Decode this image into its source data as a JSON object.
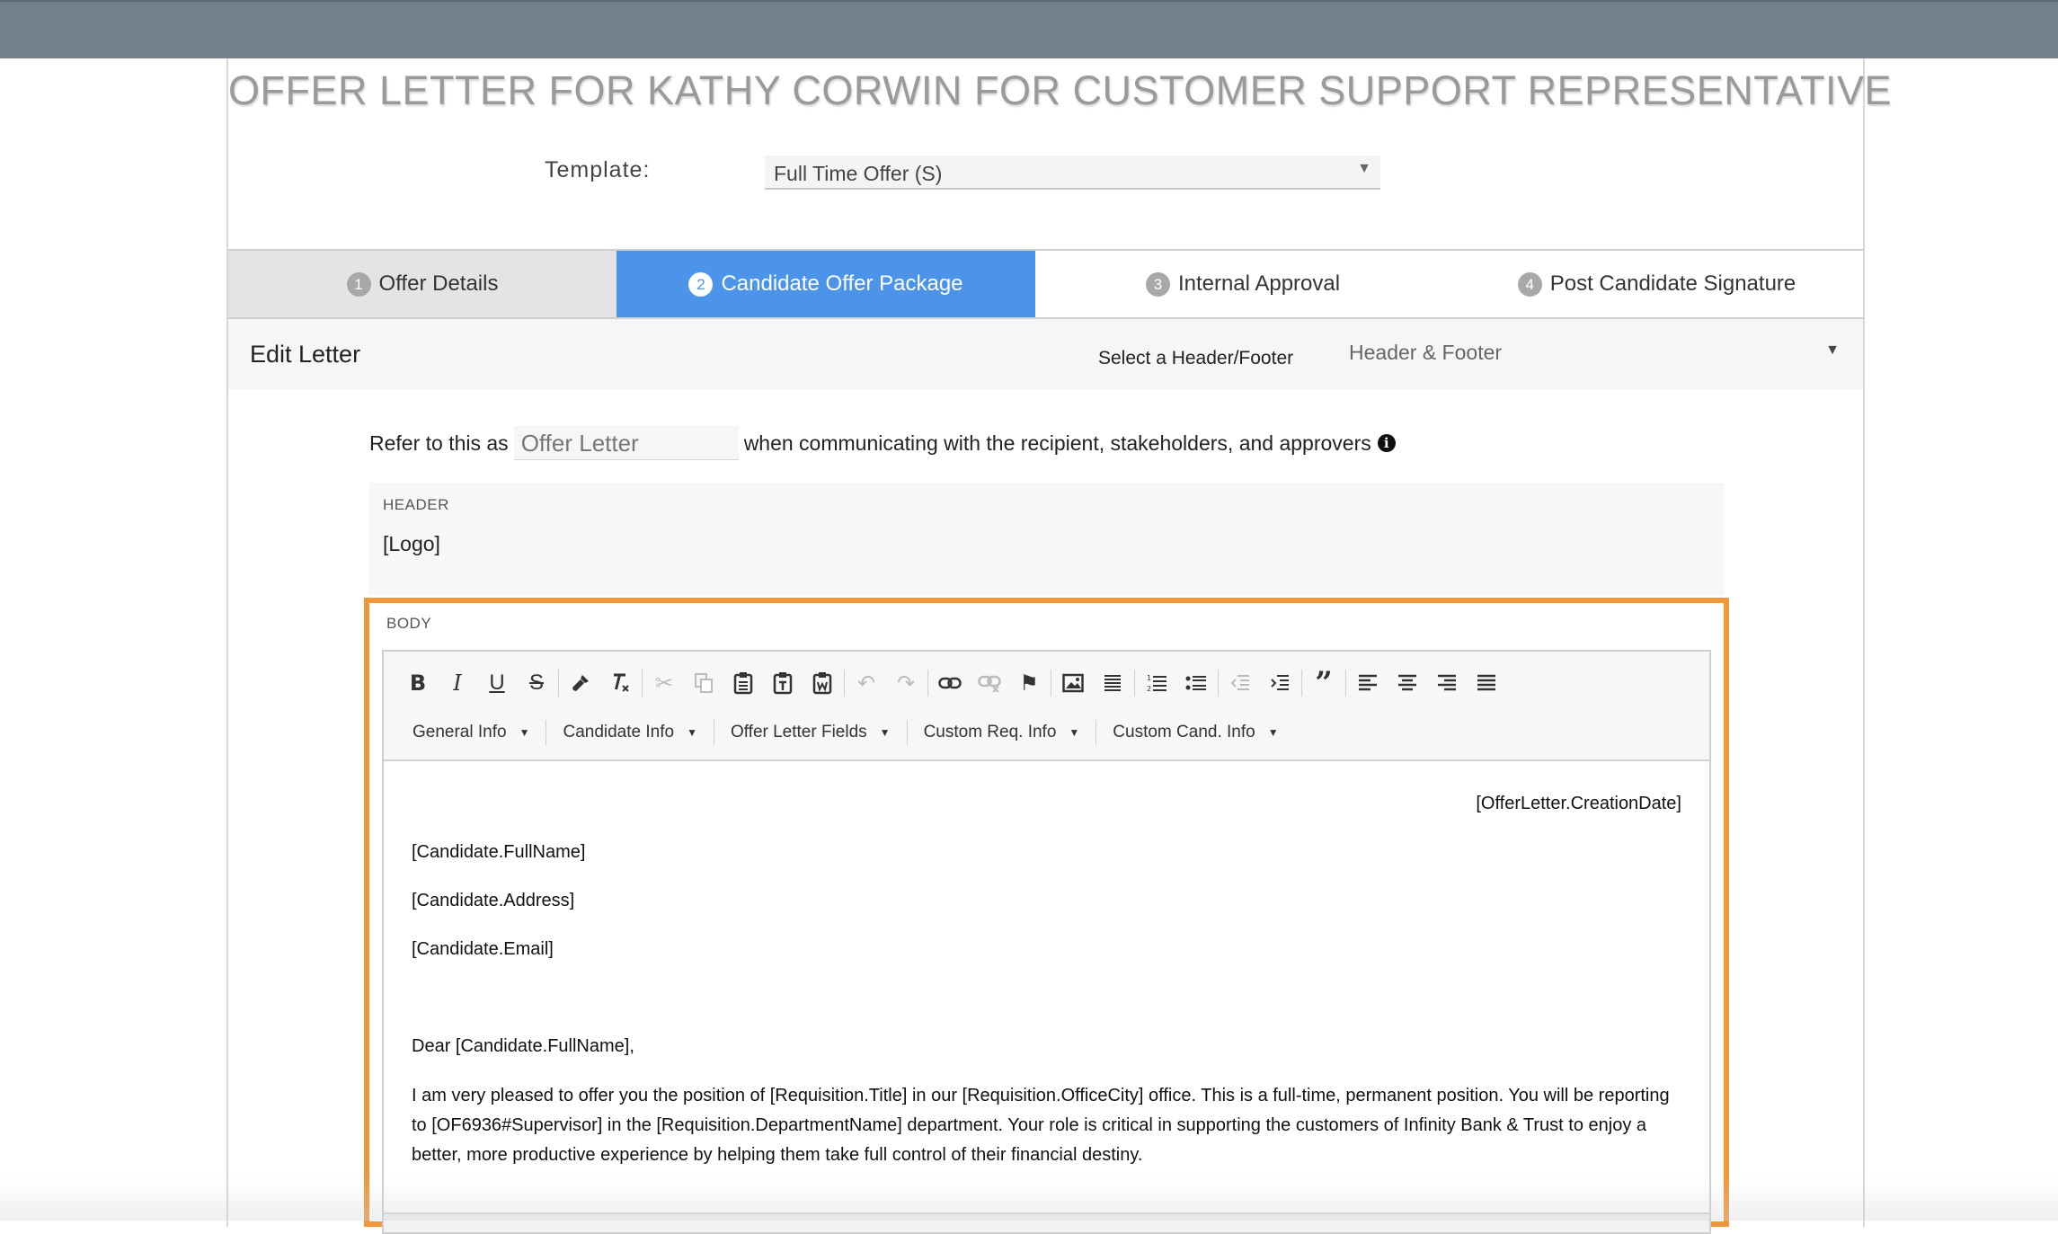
{
  "page": {
    "title": "OFFER LETTER FOR KATHY CORWIN FOR CUSTOMER SUPPORT REPRESENTATIVE"
  },
  "template": {
    "label": "Template:",
    "value": "Full Time Offer (S)"
  },
  "tabs": [
    {
      "num": "1",
      "label": "Offer Details",
      "state": "done"
    },
    {
      "num": "2",
      "label": "Candidate Offer Package",
      "state": "active"
    },
    {
      "num": "3",
      "label": "Internal Approval",
      "state": "pending"
    },
    {
      "num": "4",
      "label": "Post Candidate Signature",
      "state": "pending"
    }
  ],
  "edit": {
    "title": "Edit Letter",
    "header_footer_label": "Select a Header/Footer",
    "header_footer_value": "Header & Footer"
  },
  "refer": {
    "before": "Refer to this as",
    "value": "Offer Letter",
    "after": "when communicating with the recipient, stakeholders, and approvers",
    "info_icon": "i"
  },
  "header_section": {
    "label": "HEADER",
    "content": "[Logo]"
  },
  "body_section": {
    "label": "BODY",
    "dropdowns": [
      "General Info",
      "Candidate Info",
      "Offer Letter Fields",
      "Custom Req. Info",
      "Custom Cand. Info"
    ],
    "content": {
      "date": "[OfferLetter.CreationDate]",
      "name": "[Candidate.FullName]",
      "address": "[Candidate.Address]",
      "email": "[Candidate.Email]",
      "salutation": "Dear [Candidate.FullName],",
      "paragraph": "I am very pleased to offer you the position of [Requisition.Title] in our [Requisition.OfficeCity] office. This is a full-time, permanent position. You will be reporting to [OF6936#Supervisor] in the [Requisition.DepartmentName] department. Your role is critical in supporting the customers of Infinity Bank & Trust to enjoy a better, more productive experience by helping them take full control of their financial destiny."
    }
  },
  "colors": {
    "topbar": "#737f8b",
    "active_tab": "#4b94e9",
    "body_highlight": "#f0973b"
  }
}
